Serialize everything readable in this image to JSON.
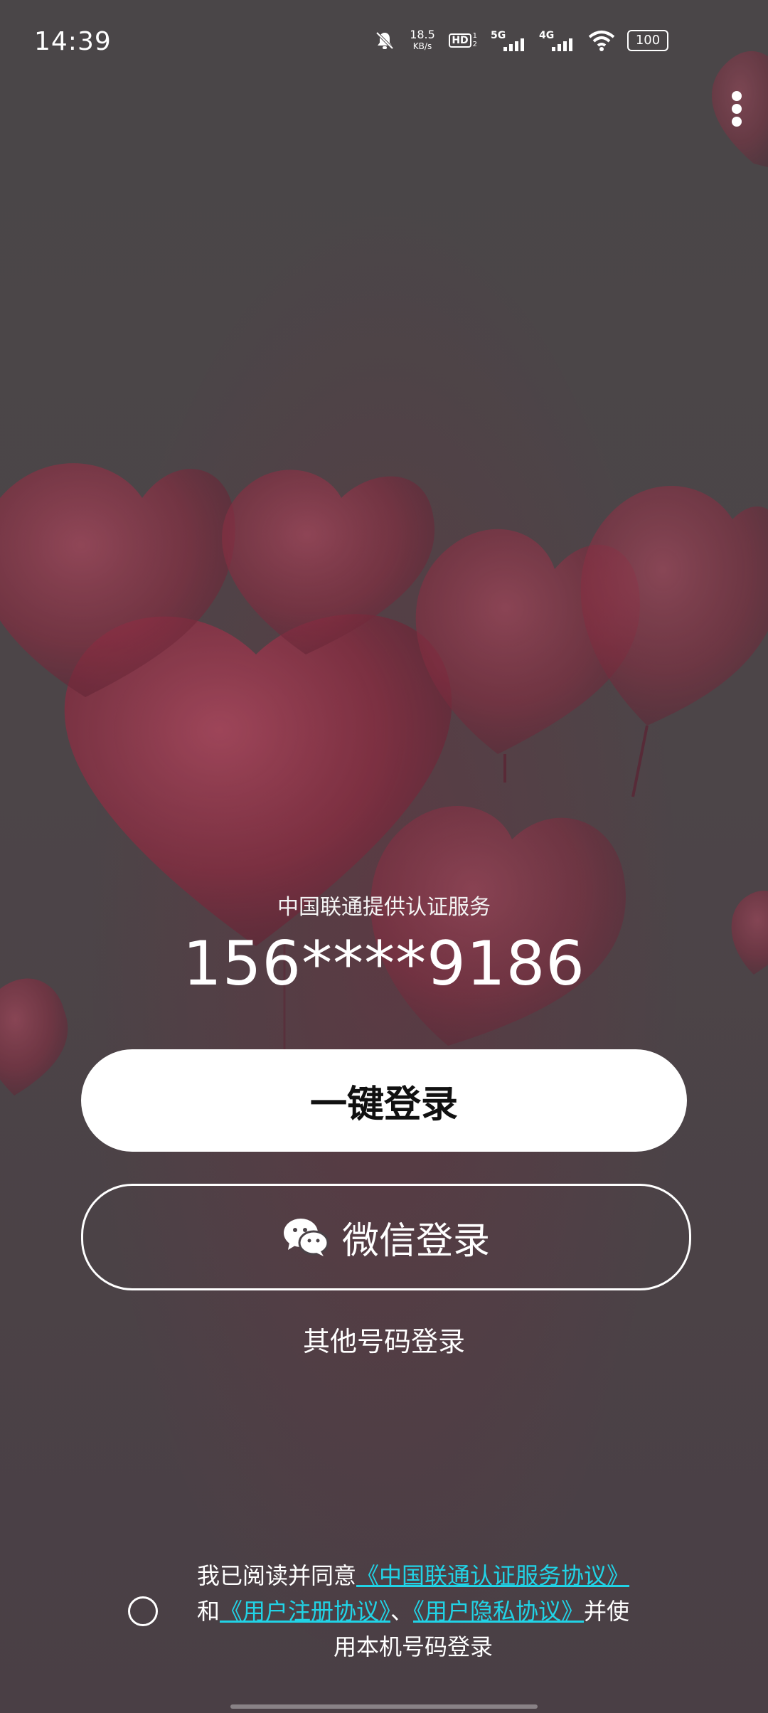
{
  "status_bar": {
    "time": "14:39",
    "network_speed_value": "18.5",
    "network_speed_unit": "KB/s",
    "hd_label": "HD",
    "hd_sub": "1 2",
    "fiveg_label": "5G",
    "fourg_label": "4G",
    "battery": "100",
    "icons": [
      "mute-bell-icon",
      "hd-icon",
      "5g-signal-icon",
      "4g-signal-icon",
      "wifi-icon",
      "battery-icon"
    ]
  },
  "top_menu": {
    "icon": "more-vertical-icon"
  },
  "login": {
    "provider_text": "中国联通提供认证服务",
    "masked_phone": "156****9186",
    "one_click_label": "一键登录",
    "wechat_label": "微信登录",
    "wechat_icon": "wechat-icon",
    "other_number_label": "其他号码登录"
  },
  "agreement": {
    "prefix": "我已阅读并同意",
    "link1": "《中国联通认证服务协议》",
    "mid1": "和",
    "link2": "《用户注册协议》",
    "sep": "、",
    "link3": "《用户隐私协议》",
    "suffix": "并使用本机号码登录",
    "link_color": "#21d3e6"
  },
  "colors": {
    "background": "#4b4449",
    "primary_button_bg": "#ffffff",
    "primary_button_text": "#111111"
  }
}
